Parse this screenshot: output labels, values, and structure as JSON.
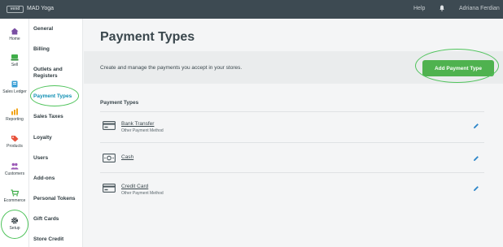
{
  "topbar": {
    "logo": "vend",
    "store": "MAD Yoga",
    "help": "Help",
    "user": "Adriana Ferdian"
  },
  "nav": [
    {
      "label": "Home"
    },
    {
      "label": "Sell"
    },
    {
      "label": "Sales Ledger"
    },
    {
      "label": "Reporting"
    },
    {
      "label": "Products"
    },
    {
      "label": "Customers"
    },
    {
      "label": "Ecommerce"
    },
    {
      "label": "Setup"
    }
  ],
  "sub": [
    {
      "label": "General"
    },
    {
      "label": "Billing"
    },
    {
      "label": "Outlets and Registers"
    },
    {
      "label": "Payment Types"
    },
    {
      "label": "Sales Taxes"
    },
    {
      "label": "Loyalty"
    },
    {
      "label": "Users"
    },
    {
      "label": "Add-ons"
    },
    {
      "label": "Personal Tokens"
    },
    {
      "label": "Gift Cards"
    },
    {
      "label": "Store Credit"
    }
  ],
  "page": {
    "title": "Payment Types",
    "description": "Create and manage the payments you accept in your stores.",
    "add_button": "Add Payment Type",
    "section_title": "Payment Types"
  },
  "payments": [
    {
      "name": "Bank Transfer",
      "sub": "Other Payment Method",
      "icon": "card-icon"
    },
    {
      "name": "Cash",
      "sub": "",
      "icon": "cash-icon"
    },
    {
      "name": "Credit Card",
      "sub": "Other Payment Method",
      "icon": "card-icon"
    }
  ],
  "colors": {
    "accent": "#4fb24f",
    "active": "#0f8fb3",
    "topbar": "#3d4a52",
    "highlight_ring": "#4fc35b"
  }
}
